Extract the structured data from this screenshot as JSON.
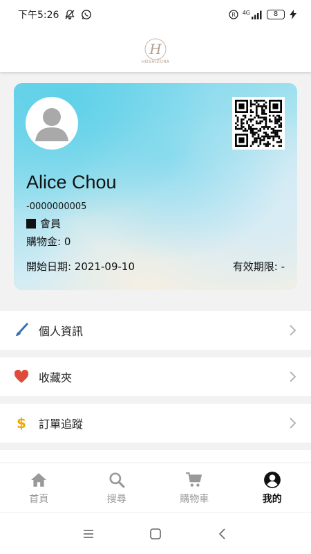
{
  "status_bar": {
    "time": "下午5:26",
    "network": "4G",
    "battery": "8",
    "icons": [
      "mute-icon",
      "whatsapp-icon",
      "registered-icon",
      "signal-icon",
      "charging-icon"
    ]
  },
  "header": {
    "logo_letter": "H",
    "logo_text": "HOSHIZORA"
  },
  "member_card": {
    "name": "Alice Chou",
    "member_id": "-0000000005",
    "level": "會員",
    "credit": "購物金: 0",
    "start_date": "開始日期: 2021-09-10",
    "expiry": "有效期限: -"
  },
  "menu": [
    {
      "label": "個人資訊",
      "icon": "brush-icon",
      "color": "#3a6fb0"
    },
    {
      "label": "收藏夾",
      "icon": "heart-icon",
      "color": "#e04a3a"
    },
    {
      "label": "訂單追蹤",
      "icon": "dollar-icon",
      "color": "#f0a800"
    }
  ],
  "bottom_nav": [
    {
      "label": "首頁",
      "icon": "home-icon",
      "active": false
    },
    {
      "label": "搜尋",
      "icon": "search-icon",
      "active": false
    },
    {
      "label": "購物車",
      "icon": "cart-icon",
      "active": false
    },
    {
      "label": "我的",
      "icon": "account-icon",
      "active": true
    }
  ],
  "system_nav": [
    "menu-icon",
    "home-square-icon",
    "back-icon"
  ]
}
